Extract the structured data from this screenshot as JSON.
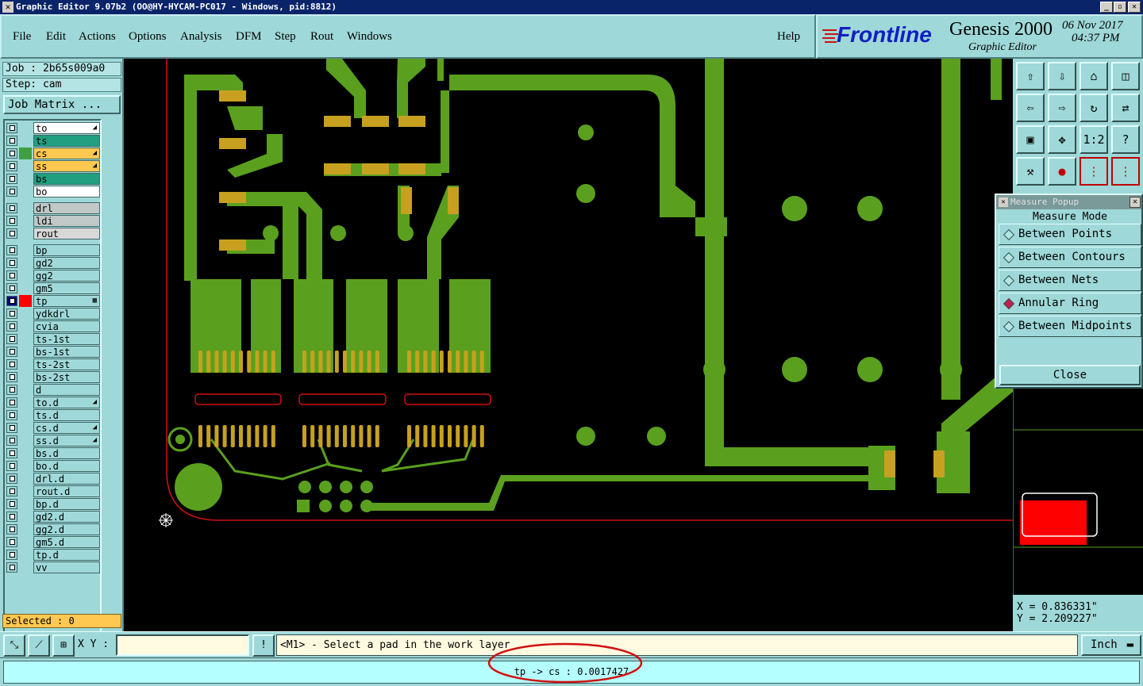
{
  "window": {
    "title": "Graphic Editor 9.07b2 (OO@HY-HYCAM-PC017 - Windows, pid:8812)"
  },
  "menu": [
    "File",
    "Edit",
    "Actions",
    "Options",
    "Analysis",
    "DFM",
    "Step",
    "Rout",
    "Windows"
  ],
  "help_label": "Help",
  "brand": {
    "logo": "Frontline",
    "product": "Genesis 2000",
    "subtitle": "Graphic Editor",
    "date": "06 Nov 2017",
    "time": "04:37 PM"
  },
  "job": {
    "job_label": "Job : 2b65s009a0",
    "step_label": "Step: cam",
    "matrix_button": "Job Matrix ..."
  },
  "layers": [
    {
      "name": "to",
      "color": "#ffffff",
      "mark": "◢"
    },
    {
      "name": "ts",
      "color": "#20a080",
      "mark": ""
    },
    {
      "name": "cs",
      "color": "#ffc850",
      "mark": "◢",
      "swatch": "#40a040"
    },
    {
      "name": "ss",
      "color": "#ffc850",
      "mark": "◢"
    },
    {
      "name": "bs",
      "color": "#20a080",
      "mark": ""
    },
    {
      "name": "bo",
      "color": "#ffffff",
      "mark": ""
    },
    {
      "name": "drl",
      "color": "#c0c8c8",
      "mark": ""
    },
    {
      "name": "ldi",
      "color": "#c0c8c8",
      "mark": ""
    },
    {
      "name": "rout",
      "color": "#d8d8d8",
      "mark": ""
    },
    {
      "name": "bp",
      "color": "#9fd8d8",
      "mark": ""
    },
    {
      "name": "gd2",
      "color": "#9fd8d8",
      "mark": ""
    },
    {
      "name": "gg2",
      "color": "#9fd8d8",
      "mark": ""
    },
    {
      "name": "gm5",
      "color": "#9fd8d8",
      "mark": ""
    },
    {
      "name": "tp",
      "color": "#9fd8d8",
      "mark": "▦",
      "swatch": "#ff0000",
      "active": true
    },
    {
      "name": "ydkdrl",
      "color": "#9fd8d8",
      "mark": ""
    },
    {
      "name": "cvia",
      "color": "#9fd8d8",
      "mark": ""
    },
    {
      "name": "ts-1st",
      "color": "#9fd8d8",
      "mark": ""
    },
    {
      "name": "bs-1st",
      "color": "#9fd8d8",
      "mark": ""
    },
    {
      "name": "ts-2st",
      "color": "#9fd8d8",
      "mark": ""
    },
    {
      "name": "bs-2st",
      "color": "#9fd8d8",
      "mark": ""
    },
    {
      "name": "d",
      "color": "#9fd8d8",
      "mark": ""
    },
    {
      "name": "to.d",
      "color": "#9fd8d8",
      "mark": "◢"
    },
    {
      "name": "ts.d",
      "color": "#9fd8d8",
      "mark": ""
    },
    {
      "name": "cs.d",
      "color": "#9fd8d8",
      "mark": "◢"
    },
    {
      "name": "ss.d",
      "color": "#9fd8d8",
      "mark": "◢"
    },
    {
      "name": "bs.d",
      "color": "#9fd8d8",
      "mark": ""
    },
    {
      "name": "bo.d",
      "color": "#9fd8d8",
      "mark": ""
    },
    {
      "name": "drl.d",
      "color": "#9fd8d8",
      "mark": ""
    },
    {
      "name": "rout.d",
      "color": "#9fd8d8",
      "mark": ""
    },
    {
      "name": "bp.d",
      "color": "#9fd8d8",
      "mark": ""
    },
    {
      "name": "gd2.d",
      "color": "#9fd8d8",
      "mark": ""
    },
    {
      "name": "gg2.d",
      "color": "#9fd8d8",
      "mark": ""
    },
    {
      "name": "gm5.d",
      "color": "#9fd8d8",
      "mark": ""
    },
    {
      "name": "tp.d",
      "color": "#9fd8d8",
      "mark": ""
    },
    {
      "name": "vv",
      "color": "#9fd8d8",
      "mark": ""
    }
  ],
  "selected_label": "Selected : 0",
  "measure": {
    "title": "Measure Popup",
    "mode_label": "Measure Mode",
    "options": [
      {
        "label": "Between Points",
        "selected": false
      },
      {
        "label": "Between Contours",
        "selected": false
      },
      {
        "label": "Between Nets",
        "selected": false
      },
      {
        "label": "Annular Ring",
        "selected": true
      },
      {
        "label": "Between Midpoints",
        "selected": false
      }
    ],
    "close_label": "Close"
  },
  "coords": {
    "x": "X = 0.836331\"",
    "y": "Y = 2.209227\""
  },
  "toolbar_icons": [
    "zoom-home-icon",
    "zoom-in-icon",
    "zoom-out-icon",
    "fit-icon",
    "pan-left-icon",
    "pan-right-icon",
    "pan-center-icon",
    "flip-icon",
    "zoom-box-icon",
    "zoom-all-icon",
    "ratio-icon",
    "help-icon",
    "measure-tool-icon",
    "snap-icon",
    "layer-compare-icon",
    "layer-compare-2-icon"
  ],
  "ratio_label": "1:2",
  "status": {
    "xy_label": "X Y :",
    "xy_value": "",
    "message": "<M1> - Select a pad in the work layer",
    "unit": "Inch",
    "result": "tp -> cs : 0.0017427"
  },
  "colors": {
    "panel": "#9fd8d8",
    "copper": "#5aa01e",
    "pad": "#c8a020",
    "outline": "#d01010"
  }
}
